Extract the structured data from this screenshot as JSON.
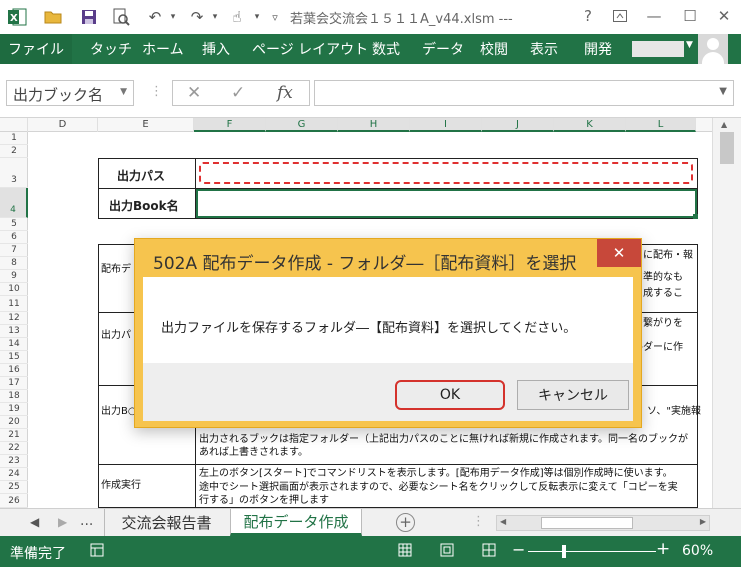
{
  "app": {
    "title": "若葉会交流会１５１１A_v44.xlsm ---",
    "excel_color": "#217346"
  },
  "ribbon": {
    "file": "ファイル",
    "tabs": [
      "タッチ",
      "ホーム",
      "挿入",
      "ページ レイアウト",
      "数式",
      "データ",
      "校閲",
      "表示",
      "開発"
    ]
  },
  "formula_bar": {
    "name_box": "出力ブック名",
    "fx": "fx",
    "value": ""
  },
  "grid": {
    "columns": [
      "D",
      "E",
      "F",
      "G",
      "H",
      "I",
      "J",
      "K",
      "L"
    ],
    "rows": [
      "1",
      "2",
      "3",
      "4",
      "5",
      "6",
      "7",
      "8",
      "9",
      "10",
      "11",
      "12",
      "13",
      "14",
      "15",
      "16",
      "17",
      "18",
      "19",
      "20",
      "21",
      "22",
      "23",
      "24",
      "25",
      "26"
    ],
    "labels": {
      "output_path": "出力パス",
      "output_book_name": "出力Book名"
    },
    "info_table": {
      "r1_label": "配布デ",
      "r1_right": [
        "に配布・報",
        "準的なも",
        "成するこ"
      ],
      "r2_label": "出力パ",
      "r2_right": [
        "の繋がりを",
        "ルダーに作"
      ],
      "r3_label": "出力B○",
      "r3_right": [
        "ソ、\"実施報"
      ],
      "r3_text": [
        "出力されるブックは指定フォルダー（上記出力パスのことに無ければ新規に作成されます。同一名のブックが",
        "あれば上書きされます。"
      ],
      "r4_label": "作成実行",
      "r4_text": [
        "左上のボタン[スタート]でコマンドリストを表示します。[配布用データ作成]等は個別作成時に使います。",
        "途中でシート選択画面が表示されますので、必要なシート名をクリックして反転表示に変えて「コピーを実",
        "行する」のボタンを押します"
      ]
    }
  },
  "sheet_tabs": {
    "more": "...",
    "tabs": [
      "交流会報告書",
      "配布データ作成"
    ],
    "active": "配布データ作成"
  },
  "status_bar": {
    "text": "準備完了",
    "zoom": "60%"
  },
  "dialog": {
    "title": "502A 配布データ作成 - フォルダ―［配布資料］を選択",
    "message": "出力ファイルを保存するフォルダ―【配布資料】を選択してください。",
    "ok": "OK",
    "cancel": "キャンセル"
  }
}
